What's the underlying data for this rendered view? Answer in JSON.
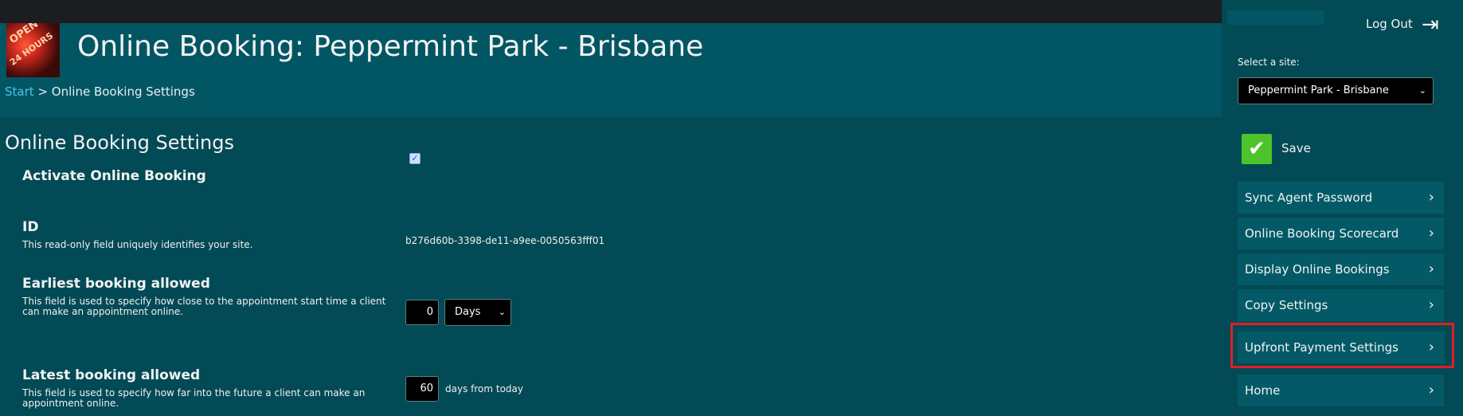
{
  "header": {
    "logo_text": [
      "OPEN",
      "24 HOURS"
    ],
    "title": "Online Booking: Peppermint Park - Brisbane",
    "breadcrumb": {
      "start": "Start",
      "separator": ">",
      "current": "Online Booking Settings"
    }
  },
  "section": {
    "title": "Online Booking Settings",
    "activate": {
      "label": "Activate Online Booking",
      "checked": true
    },
    "id_field": {
      "label": "ID",
      "description": "This read-only field uniquely identifies your site.",
      "value": "b276d60b-3398-de11-a9ee-0050563fff01"
    },
    "earliest": {
      "label": "Earliest booking allowed",
      "description": "This field is used to specify how close to the appointment start time a client can make an appointment online.",
      "value": "0",
      "unit": "Days"
    },
    "latest": {
      "label": "Latest booking allowed",
      "description": "This field is used to specify how far into the future a client can make an appointment online.",
      "value": "60",
      "suffix": "days from today"
    }
  },
  "sidebar": {
    "logout_label": "Log Out",
    "site_label": "Select a site:",
    "site_selected": "Peppermint Park - Brisbane",
    "save_label": "Save",
    "menu": [
      "Sync Agent Password",
      "Online Booking Scorecard",
      "Display Online Bookings",
      "Copy Settings",
      "Upfront Payment Settings",
      "Home"
    ]
  },
  "colors": {
    "background": "#024a55",
    "header": "#025663",
    "link": "#4fc3e8",
    "save_green": "#4dc42b",
    "highlight_red": "#e31d25"
  }
}
